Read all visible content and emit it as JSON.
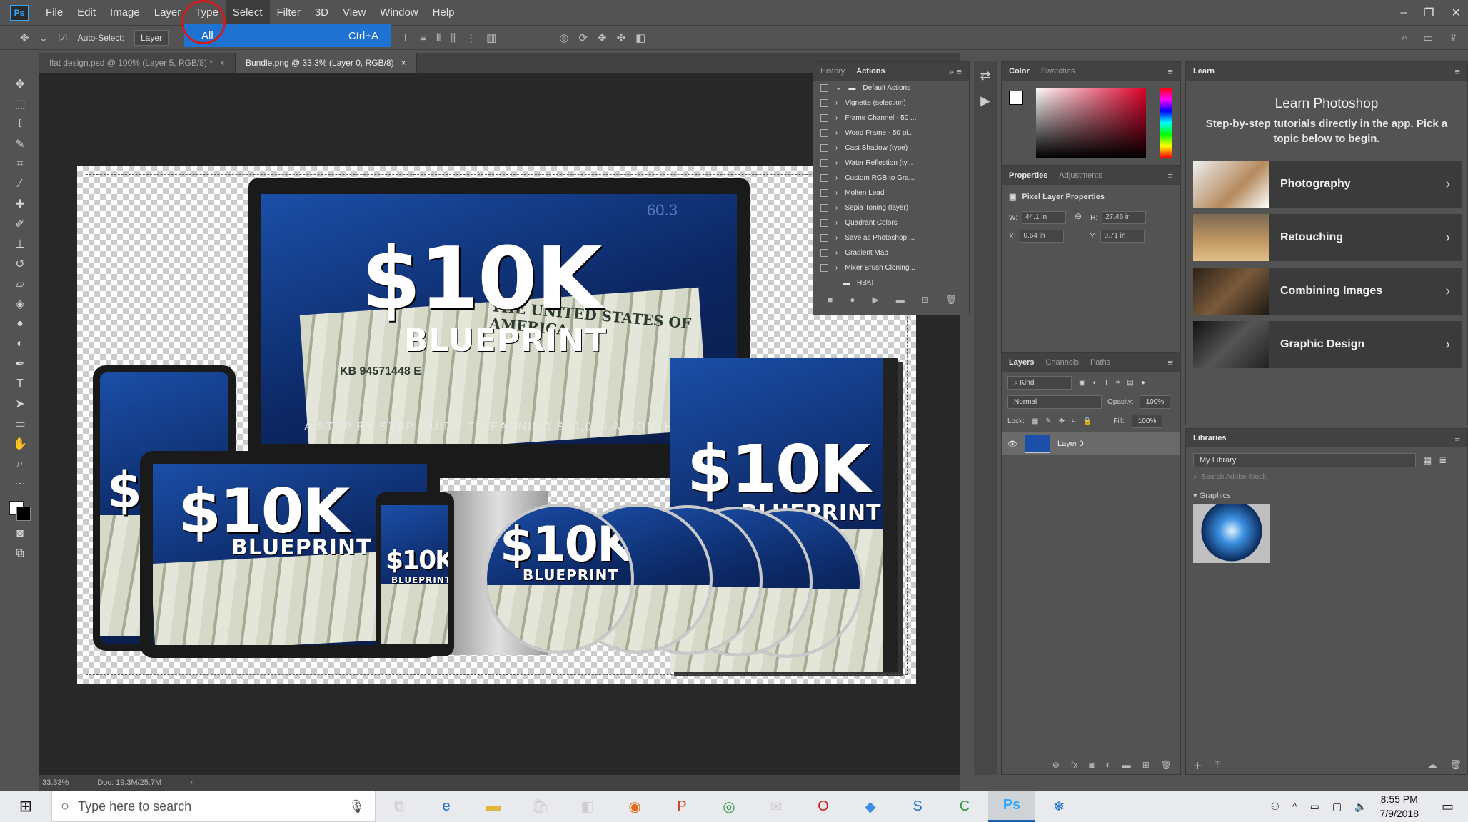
{
  "app": {
    "logo": "Ps"
  },
  "menubar": {
    "items": [
      "File",
      "Edit",
      "Image",
      "Layer",
      "Type",
      "Select",
      "Filter",
      "3D",
      "View",
      "Window",
      "Help"
    ]
  },
  "select_menu": {
    "item_label": "All",
    "shortcut": "Ctrl+A"
  },
  "options_bar": {
    "auto_select_label": "Auto-Select:",
    "auto_select_target": "Layer"
  },
  "tabs": [
    {
      "label": "flat design.psd @ 100% (Layer 5, RGB/8) *"
    },
    {
      "label": "Bundle.png @ 33.3% (Layer 0, RGB/8)"
    }
  ],
  "status": {
    "zoom": "33.33%",
    "doc": "Doc: 19.3M/25.7M"
  },
  "artwork": {
    "brand_main": "$10K",
    "brand_sub": "BLUEPRINT",
    "tagline": "A STEP BY STEP GUIDE TO EARNING $10,000 A MONTH",
    "bill_text": "THE UNITED STATES OF AMERICA",
    "serial": "KB 94571448 E",
    "monitor_number": "60.3"
  },
  "history_actions_panel": {
    "tabs": [
      "History",
      "Actions"
    ],
    "active_tab": "Actions",
    "folder": "Default Actions",
    "actions": [
      "Vignette (selection)",
      "Frame Channel - 50 ...",
      "Wood Frame - 50 pi...",
      "Cast Shadow (type)",
      "Water Reflection (ty...",
      "Custom RGB to Gra...",
      "Molten Lead",
      "Sepia Toning (layer)",
      "Quadrant Colors",
      "Save as Photoshop ...",
      "Gradient Map",
      "Mixer Brush Cloning..."
    ],
    "extra_folder": "HBKI"
  },
  "color_panel": {
    "tabs": [
      "Color",
      "Swatches"
    ],
    "active_tab": "Color"
  },
  "properties_panel": {
    "tabs": [
      "Properties",
      "Adjustments"
    ],
    "active_tab": "Properties",
    "title": "Pixel Layer Properties",
    "w": "44.1 in",
    "h": "27.46 in",
    "x": "0.64 in",
    "y": "0.71 in",
    "w_label": "W:",
    "h_label": "H:",
    "x_label": "X:",
    "y_label": "Y:"
  },
  "layers_panel": {
    "tabs": [
      "Layers",
      "Channels",
      "Paths"
    ],
    "active_tab": "Layers",
    "kind_label": "Kind",
    "blend_mode": "Normal",
    "opacity_label": "Opacity:",
    "opacity": "100%",
    "lock_label": "Lock:",
    "fill_label": "Fill:",
    "fill": "100%",
    "layers": [
      {
        "name": "Layer 0"
      }
    ]
  },
  "learn_panel": {
    "tab": "Learn",
    "title": "Learn Photoshop",
    "subtitle": "Step-by-step tutorials directly in the app. Pick a topic below to begin.",
    "topics": [
      "Photography",
      "Retouching",
      "Combining Images",
      "Graphic Design"
    ]
  },
  "libraries_panel": {
    "tab": "Libraries",
    "library": "My Library",
    "search_placeholder": "Search Adobe Stock",
    "group": "Graphics"
  },
  "taskbar": {
    "search_placeholder": "Type here to search",
    "time": "8:55 PM",
    "date": "7/9/2018"
  },
  "colors": {
    "accent": "#1e72d2",
    "ps_blue": "#31a8ff",
    "highlight_circle": "#d11a1a"
  }
}
